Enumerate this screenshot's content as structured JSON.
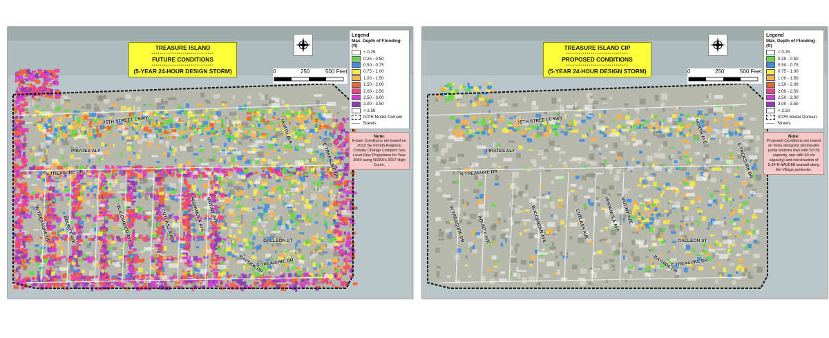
{
  "maps": [
    {
      "id": "future",
      "title_line1": "TREASURE ISLAND",
      "title_line2": "FUTURE CONDITIONS",
      "title_line3": "(5-YEAR 24-HOUR DESIGN STORM)",
      "note_heading": "Note:",
      "note_text": "Future Conditions are based on 2019 SE Florida Regional Climate Change Compact Sea Level Rise Projections for Year 2060 using NOAA's 2017 High Curve.",
      "flood_intensity": 1.0
    },
    {
      "id": "proposed",
      "title_line1": "TREASURE ISLAND CIP",
      "title_line2": "PROPOSED CONDITIONS",
      "title_line3": "(5-YEAR 24-HOUR DESIGN STORM)",
      "note_heading": "Note:",
      "note_text": "Proposed Conditions are based on three designed stormwater pump stations (two with 50 cfs capacity, one with 60 cfs capacity) and construction of 5.34-ft-NAVD88 seawall along the Village perimeter.",
      "flood_intensity": 0.22
    }
  ],
  "legend": {
    "title": "Legend",
    "subtitle": "Max. Depth of Flooding (ft)",
    "classes": [
      {
        "label": "< 0.25",
        "color": "#ffffff"
      },
      {
        "label": "0.25 - 0.50",
        "color": "#67d94b"
      },
      {
        "label": "0.50 - 0.75",
        "color": "#3f8fe0"
      },
      {
        "label": "0.75 - 1.00",
        "color": "#f5e94a"
      },
      {
        "label": "1.00 - 1.50",
        "color": "#f9b14a"
      },
      {
        "label": "1.50 - 2.00",
        "color": "#f3632f"
      },
      {
        "label": "2.00 - 2.50",
        "color": "#f2408b"
      },
      {
        "label": "2.50 - 3.00",
        "color": "#d23fd4"
      },
      {
        "label": "3.00 - 3.50",
        "color": "#8a3fb0"
      },
      {
        "label": "> 3.50",
        "color": "#ffffff"
      }
    ],
    "domain_label": "ICPR Model Domain",
    "streets_label": "Streets"
  },
  "scale": {
    "tick0": "0",
    "tick1": "250",
    "tick2": "500 Feet"
  },
  "streets": {
    "s1": "75TH STREET CSWY",
    "s2": "PIRATES ALY",
    "s3": "N TREASURE DR",
    "s4": "E TREASURE DR",
    "s5": "S TREASURE DR",
    "s6": "GALLEON ST",
    "s7": "BOUNTY AVE",
    "s8": "BUCCANEER AVE",
    "s9": "CUTLASS AVE",
    "s10": "HISPANOLA AVE",
    "s11": "MUTINY AVE",
    "s12": "W TREASURE DR",
    "s13": "BAYSIDE DR",
    "s14": "NORTH AVE"
  }
}
